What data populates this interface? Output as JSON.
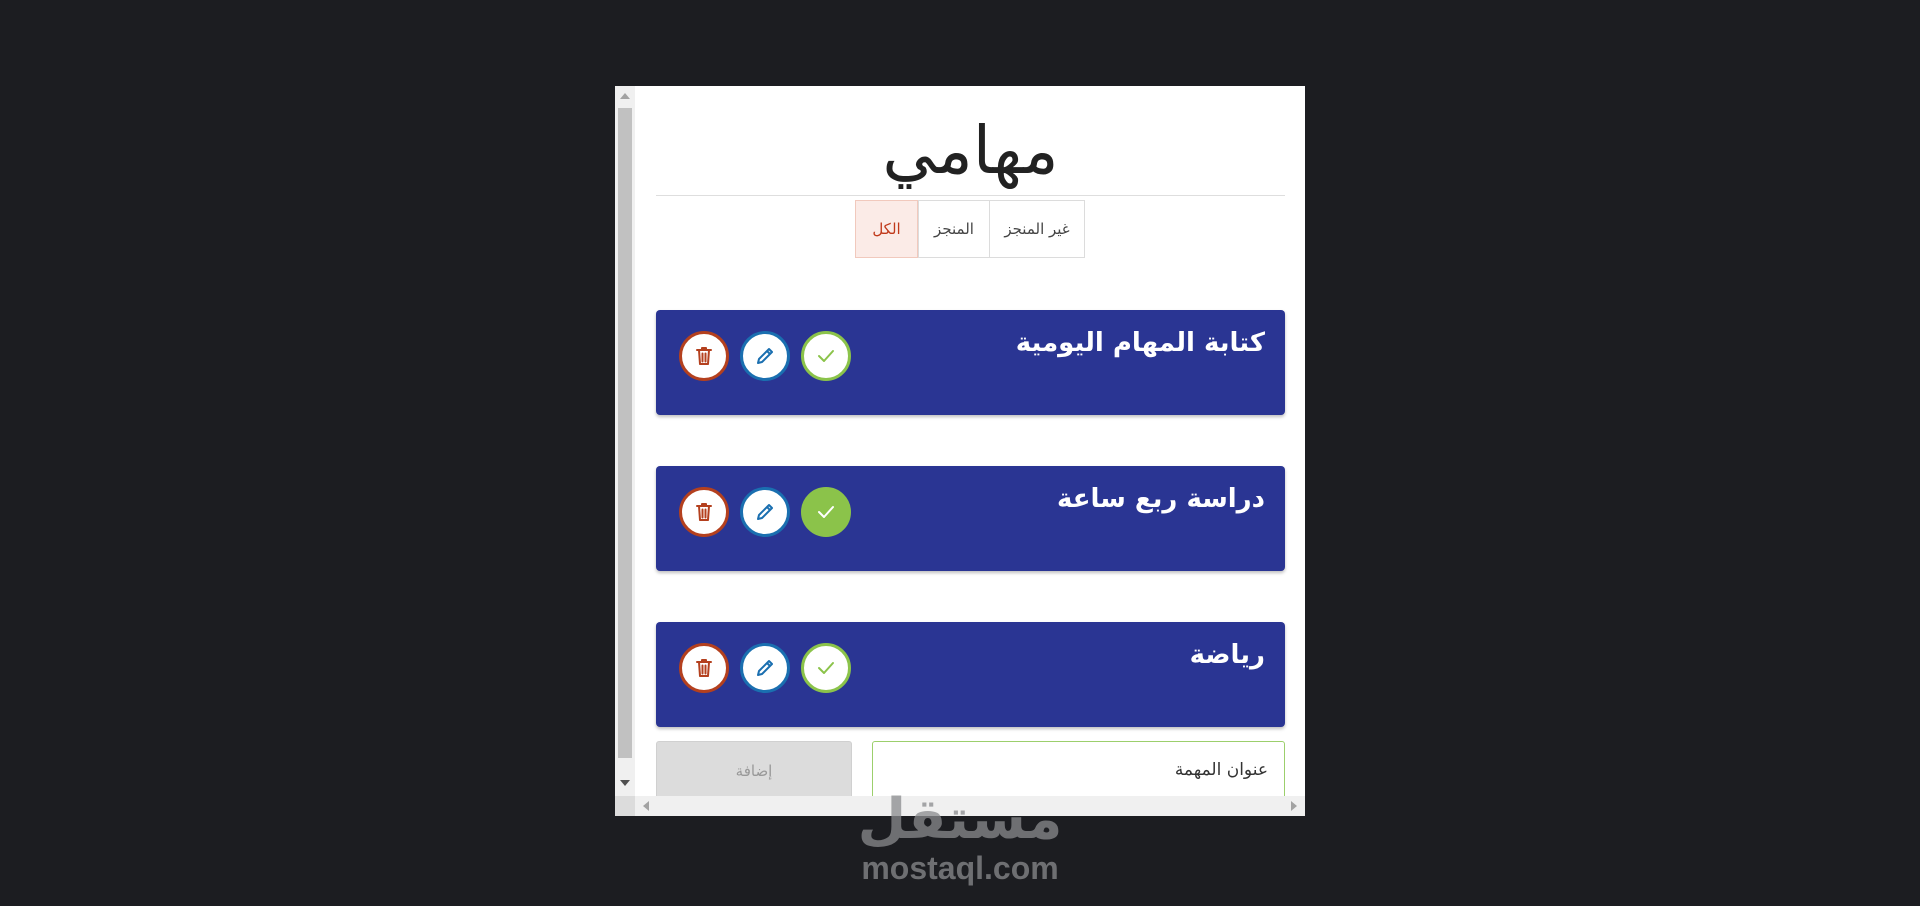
{
  "app": {
    "title": "مهامي"
  },
  "filters": {
    "tabs": [
      {
        "label": "الكل",
        "active": true
      },
      {
        "label": "المنجز",
        "active": false
      },
      {
        "label": "غير المنجز",
        "active": false
      }
    ]
  },
  "tasks": [
    {
      "title": "كتابة المهام اليومية",
      "done": false
    },
    {
      "title": "دراسة ربع ساعة",
      "done": true
    },
    {
      "title": "رياضة",
      "done": false
    }
  ],
  "add_form": {
    "input_value": "عنوان المهمة",
    "button_label": "إضافة"
  },
  "icons": {
    "delete": "trash-icon",
    "edit": "pencil-icon",
    "done": "check-icon"
  },
  "colors": {
    "page_background": "#1c1d21",
    "card": "#2a3593",
    "delete": "#b4401e",
    "edit": "#1a6fb0",
    "done": "#8bc34a",
    "active_tab_text": "#c0391b",
    "active_tab_bg": "#fbebe7"
  },
  "watermark": {
    "arabic": "مستقل",
    "latin": "mostaql.com"
  }
}
